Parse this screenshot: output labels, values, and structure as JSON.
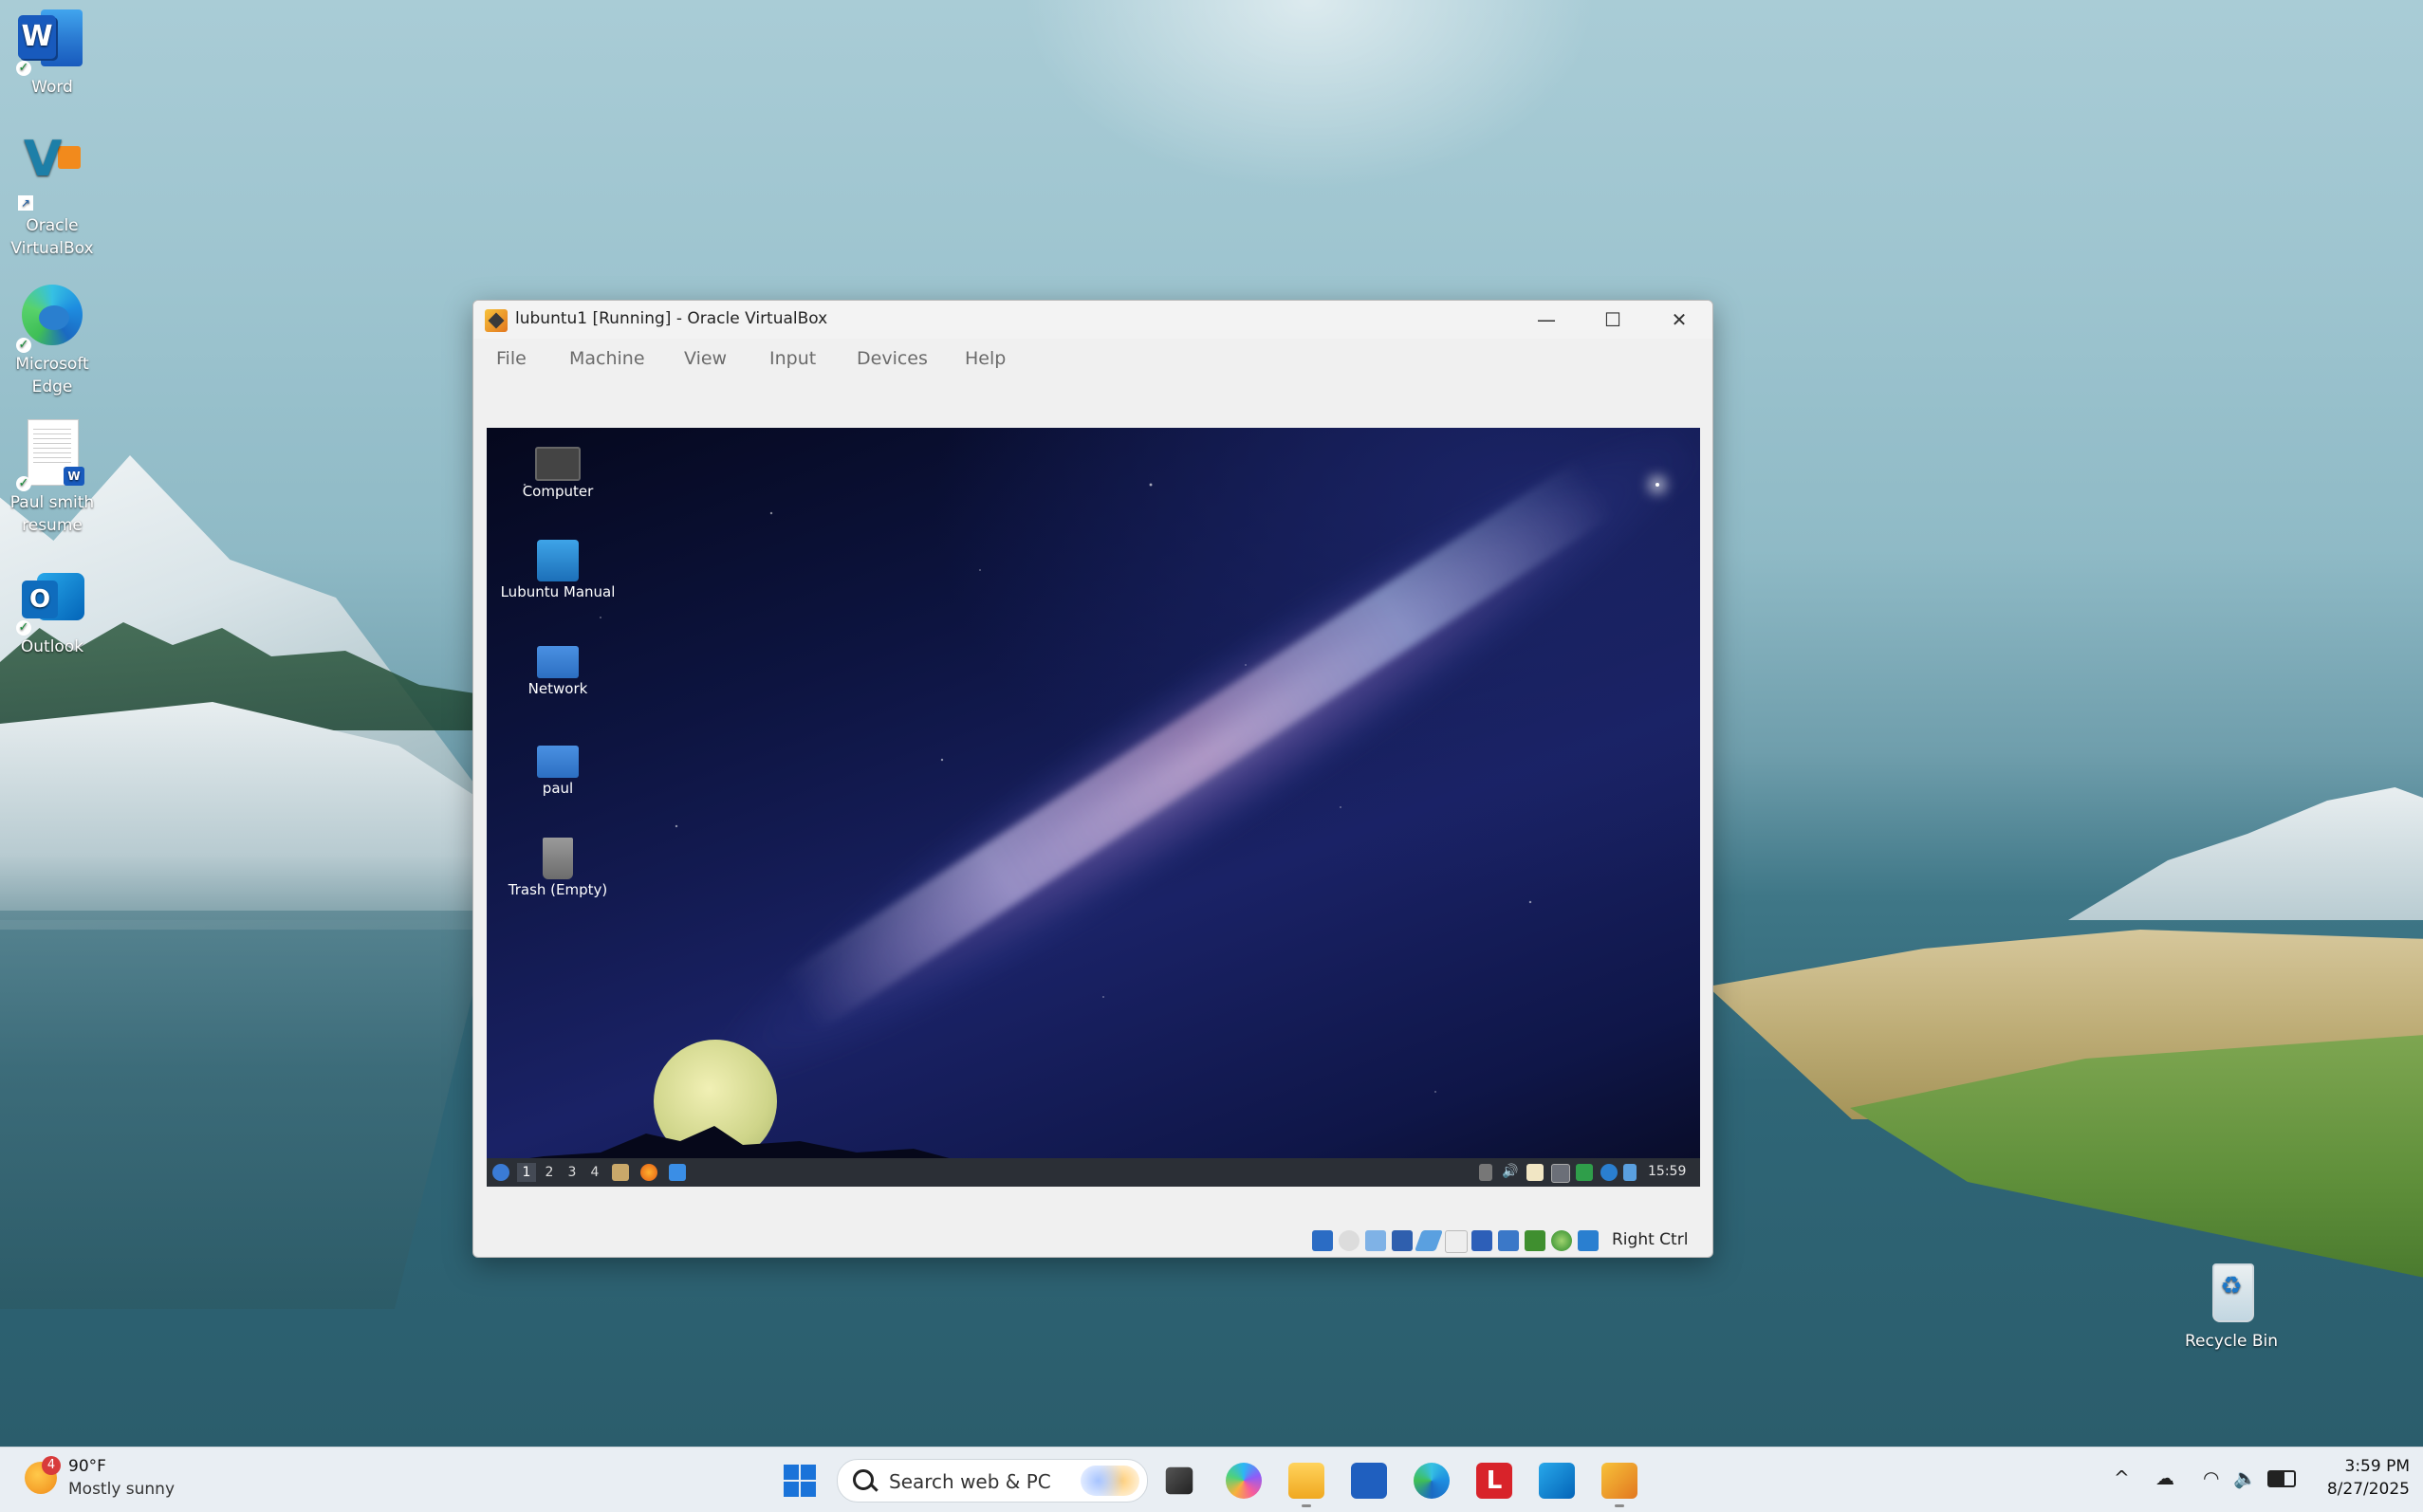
{
  "host_desktop": {
    "icons": [
      {
        "label": "Word",
        "icon": "word-icon"
      },
      {
        "label": "Oracle VirtualBox",
        "icon": "virtualbox-icon"
      },
      {
        "label": "Microsoft Edge",
        "icon": "edge-icon"
      },
      {
        "label": "Paul smith resume",
        "icon": "word-document-icon"
      },
      {
        "label": "Outlook",
        "icon": "outlook-icon"
      },
      {
        "label": "Recycle Bin",
        "icon": "recycle-bin-icon"
      }
    ]
  },
  "vbox_window": {
    "title": "lubuntu1 [Running] - Oracle VirtualBox",
    "controls": {
      "minimize": "—",
      "maximize": "☐",
      "close": "✕"
    },
    "menu": [
      "File",
      "Machine",
      "View",
      "Input",
      "Devices",
      "Help"
    ],
    "guest": {
      "desktop_icons": [
        {
          "label": "Computer",
          "icon": "computer-icon"
        },
        {
          "label": "Lubuntu Manual",
          "icon": "manual-icon"
        },
        {
          "label": "Network",
          "icon": "network-folder-icon"
        },
        {
          "label": "paul",
          "icon": "home-folder-icon"
        },
        {
          "label": "Trash (Empty)",
          "icon": "trash-icon"
        }
      ],
      "panel": {
        "workspaces": [
          "1",
          "2",
          "3",
          "4"
        ],
        "active_workspace": "1",
        "clock": "15:59"
      }
    },
    "status_bar": {
      "host_key": "Right Ctrl"
    }
  },
  "taskbar": {
    "weather": {
      "temp": "90°F",
      "desc": "Mostly sunny",
      "badge": "4"
    },
    "search": {
      "placeholder": "Search web & PC"
    },
    "pinned": [
      "start-icon",
      "task-view-icon",
      "copilot-icon",
      "file-explorer-icon",
      "store-icon",
      "edge-icon",
      "lastpass-icon",
      "outlook-icon",
      "virtualbox-icon"
    ],
    "tray": {
      "chevron": "^",
      "cloud": "☁",
      "wifi": "wifi-icon",
      "volume": "volume-icon",
      "battery": "battery-icon"
    },
    "clock": {
      "time": "3:59 PM",
      "date": "8/27/2025"
    }
  },
  "colors": {
    "taskbar_bg": "#e9eef3",
    "vbox_chrome": "#f0f0f0",
    "guest_panel": "#2b2f36",
    "accent": "#0f6cbd"
  }
}
